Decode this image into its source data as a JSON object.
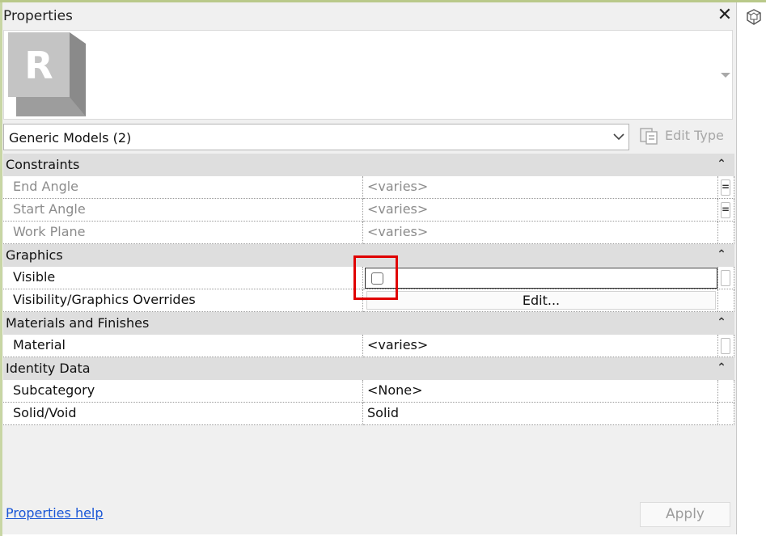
{
  "panel": {
    "title": "Properties",
    "close_glyph": "✕",
    "thumbnail": {
      "logo_letter": "R",
      "logo_icon": "revit-logo-icon"
    },
    "type_selector": {
      "value": "Generic Models (2)"
    },
    "edit_type": {
      "label": "Edit Type",
      "icon": "edit-type-icon"
    }
  },
  "grid": {
    "categories": [
      {
        "label": "Constraints",
        "rows": [
          {
            "name": "End Angle",
            "value": "<varies>",
            "disabled": true,
            "gutter": "="
          },
          {
            "name": "Start Angle",
            "value": "<varies>",
            "disabled": true,
            "gutter": "="
          },
          {
            "name": "Work Plane",
            "value": "<varies>",
            "disabled": true,
            "gutter": ""
          }
        ]
      },
      {
        "label": "Graphics",
        "rows": [
          {
            "name": "Visible",
            "value": "",
            "checked": false
          },
          {
            "name": "Visibility/Graphics Overrides",
            "value": "Edit..."
          }
        ]
      },
      {
        "label": "Materials and Finishes",
        "rows": [
          {
            "name": "Material",
            "value": "<varies>"
          }
        ]
      },
      {
        "label": "Identity Data",
        "rows": [
          {
            "name": "Subcategory",
            "value": "<None>"
          },
          {
            "name": "Solid/Void",
            "value": "Solid"
          }
        ]
      }
    ]
  },
  "footer": {
    "help_link": "Properties help",
    "apply_label": "Apply"
  },
  "colors": {
    "highlight": "#e00000",
    "link": "#1a56d6",
    "category_bg": "#dedede"
  }
}
